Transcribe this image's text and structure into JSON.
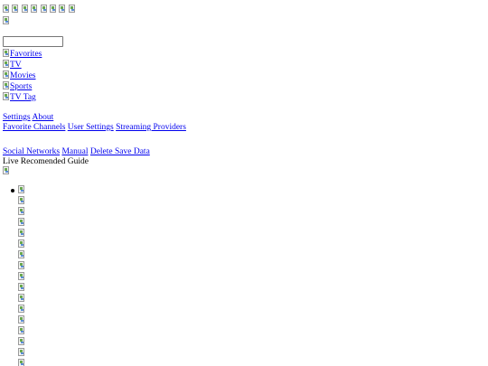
{
  "icons": {
    "top_bar": [
      "broken-image-icon",
      "broken-image-icon",
      "broken-image-icon",
      "broken-image-icon",
      "broken-image-icon",
      "broken-image-icon",
      "broken-image-icon",
      "broken-image-icon"
    ],
    "logo": "broken-image-icon",
    "banner": "broken-image-icon"
  },
  "search": {
    "value": "",
    "placeholder": ""
  },
  "nav": {
    "items": [
      {
        "label": "Favorites"
      },
      {
        "label": "TV"
      },
      {
        "label": "Movies"
      },
      {
        "label": "Sports"
      },
      {
        "label": "TV Tag"
      }
    ]
  },
  "settings_row": {
    "settings": "Settings",
    "about": "About"
  },
  "preferences_row": {
    "favorite_channels": "Favorite Channels",
    "user_settings": "User Settings",
    "streaming_providers": "Streaming Providers"
  },
  "links_row": {
    "social_networks": "Social Networks",
    "manual": "Manual",
    "delete_save_data": "Delete Save Data"
  },
  "guide_row": {
    "text": "Live Recomended Guide"
  },
  "channels": {
    "count": 17
  },
  "colors": {
    "link": "#0000ee",
    "text": "#000000",
    "background": "#ffffff"
  }
}
